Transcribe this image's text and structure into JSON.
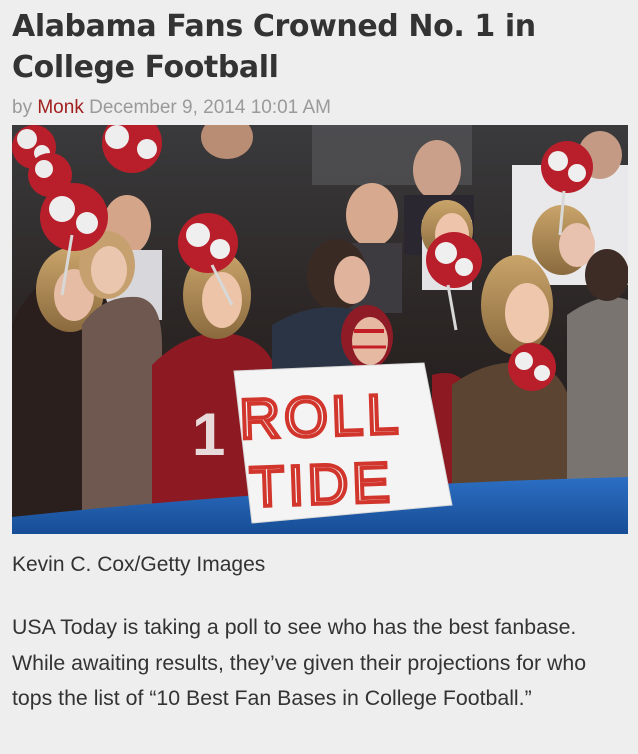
{
  "article": {
    "title": "Alabama Fans Crowned No. 1 in College Football",
    "byline": {
      "prefix": "by",
      "author": "Monk",
      "date": "December 9, 2014 10:01 AM"
    },
    "image": {
      "description": "",
      "sign_line1": "ROLL",
      "sign_line2": "TIDE"
    },
    "caption": "Kevin C. Cox/Getty Images",
    "paragraph": "USA Today is taking a poll to see who has the best fanbase. While awaiting results, they’ve given their projections for who tops the list of “10 Best Fan Bases in College Football.”"
  },
  "colors": {
    "author_link": "#a11f1f",
    "crimson": "#9e1b24",
    "wall_blue": "#1f5fb3",
    "text": "#333333",
    "muted": "#9a9a9a",
    "background": "#eeeeee"
  }
}
